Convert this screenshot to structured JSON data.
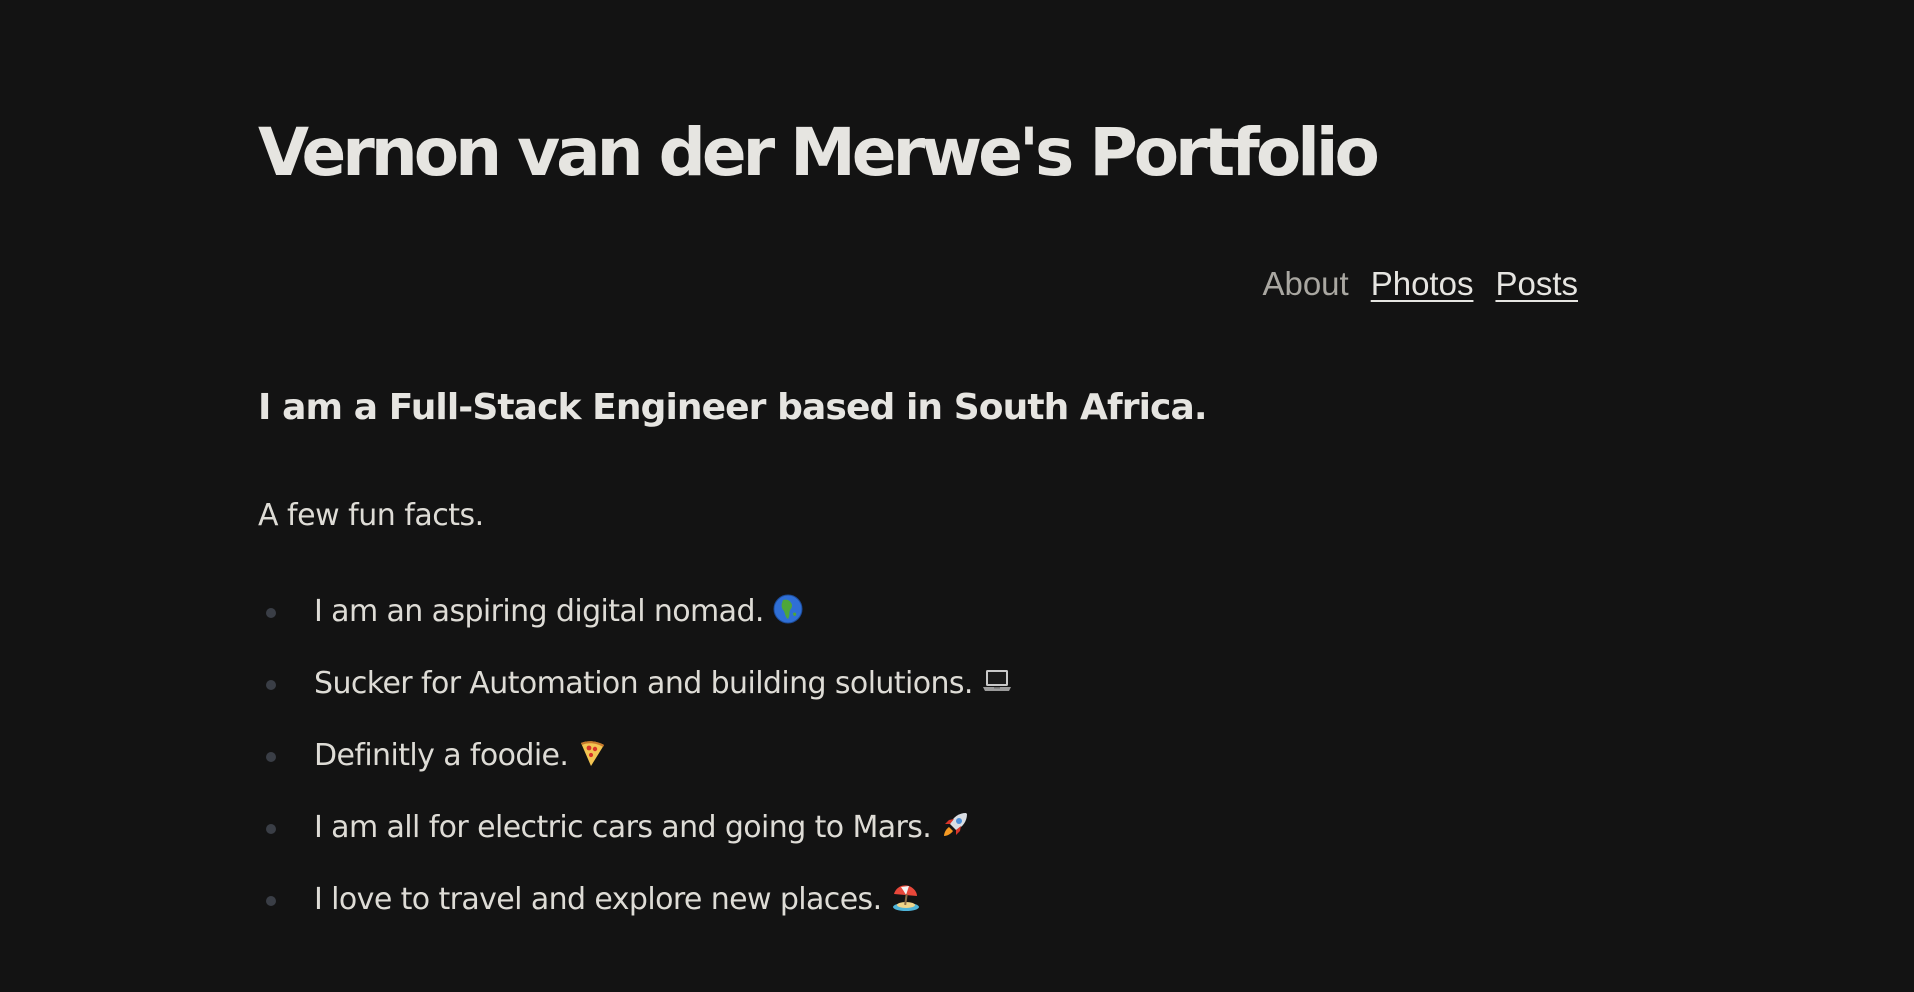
{
  "header": {
    "title": "Vernon van der Merwe's Portfolio"
  },
  "nav": {
    "items": [
      {
        "label": "About",
        "current": true
      },
      {
        "label": "Photos",
        "current": false
      },
      {
        "label": "Posts",
        "current": false
      }
    ]
  },
  "main": {
    "headline": "I am a Full-Stack Engineer based in South Africa.",
    "intro": "A few fun facts.",
    "facts": [
      {
        "text": "I am an aspiring digital nomad.",
        "icon": "globe-africa-icon"
      },
      {
        "text": "Sucker for Automation and building solutions.",
        "icon": "laptop-icon"
      },
      {
        "text": "Definitly a foodie.",
        "icon": "pizza-icon"
      },
      {
        "text": "I am all for electric cars and going to Mars.",
        "icon": "rocket-icon"
      },
      {
        "text": "I love to travel and explore new places.",
        "icon": "beach-umbrella-icon"
      }
    ]
  },
  "colors": {
    "background": "#131313",
    "text": "#e6e5e1",
    "muted": "#a9a7a1",
    "bullet": "#3a3e46"
  }
}
